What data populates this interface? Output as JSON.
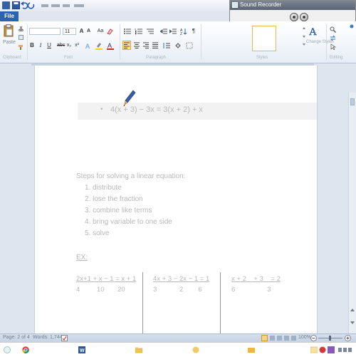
{
  "window": {
    "title": ""
  },
  "ribbon": {
    "file_tab": "File",
    "clipboard": {
      "label": "Clipboard",
      "paste_label": "Paste"
    },
    "font": {
      "label": "Font",
      "name_value": "",
      "size_value": "11"
    },
    "paragraph": {
      "label": "Paragraph"
    },
    "styles": {
      "label": "Styles",
      "change_styles_label": "Change Styles"
    },
    "editing": {
      "label": "Editing"
    }
  },
  "sound_recorder": {
    "title": "Sound Recorder"
  },
  "document": {
    "equation_bullet": "•",
    "equation": "4(x + 3) − 3x = 3(x + 2) + x",
    "steps_heading": "Steps for solving a linear equation:",
    "steps": [
      "1. distribute",
      "2. lose the fraction",
      "3. combine like terms",
      "4. bring variable to one side",
      "5. solve"
    ],
    "ex_label": "EX:",
    "fractions": [
      {
        "num_row": "2x+1  + x − 1  =  x + 1",
        "den_row": "4         10       20"
      },
      {
        "num_row": "4x + 3  −  2x − 1  = 1",
        "den_row": "3            2        6"
      },
      {
        "num_row": "x + 2    + 3    = 2",
        "den_row": "6                 3"
      }
    ]
  },
  "statusbar": {
    "page": "Page: 2 of 4",
    "words": "Words: 1,744",
    "zoom": "100%"
  },
  "colors": {
    "file_tab": "#2a62b4",
    "ribbon_bg": "#eef3f9",
    "doc_text": "#b8b8b8",
    "highlight_yellow": "#ffd200",
    "font_red": "#d8262b"
  },
  "taskbar": {
    "icons": [
      "chrome-icon",
      "word-icon",
      "folder-icon",
      "media-icon",
      "screen-recorder-icon",
      "paint-icon"
    ]
  }
}
